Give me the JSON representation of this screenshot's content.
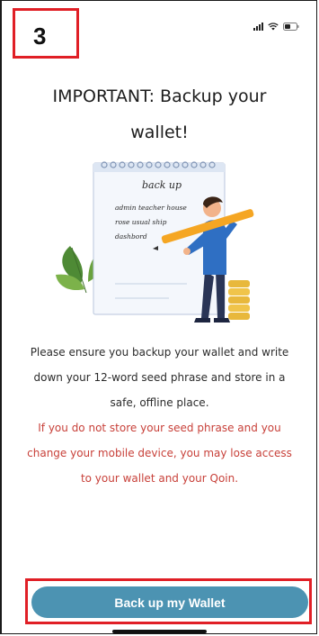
{
  "annotation": {
    "step_number": "3"
  },
  "status_bar": {
    "icons": [
      "signal-icon",
      "wifi-icon",
      "battery-icon"
    ]
  },
  "screen": {
    "title_line1": "IMPORTANT: Backup your",
    "title_line2": "wallet!",
    "illustration": {
      "note_heading": "back up",
      "note_line1": "admin teacher house",
      "note_line2": "rose usual ship",
      "note_line3": "dashbord"
    },
    "info": {
      "line1": "Please ensure you backup your wallet and write",
      "line2": "down your 12-word seed phrase and store in a",
      "line3": "safe, offline place."
    },
    "warning": {
      "line1": "If you do not store your seed phrase and you",
      "line2": "change your mobile device, you may lose access",
      "line3": "to your wallet and your Qoin."
    },
    "backup_button_label": "Back up my Wallet"
  },
  "colors": {
    "button": "#4c93b2",
    "warning_text": "#c8413a",
    "annotation_red": "#e01f26"
  }
}
